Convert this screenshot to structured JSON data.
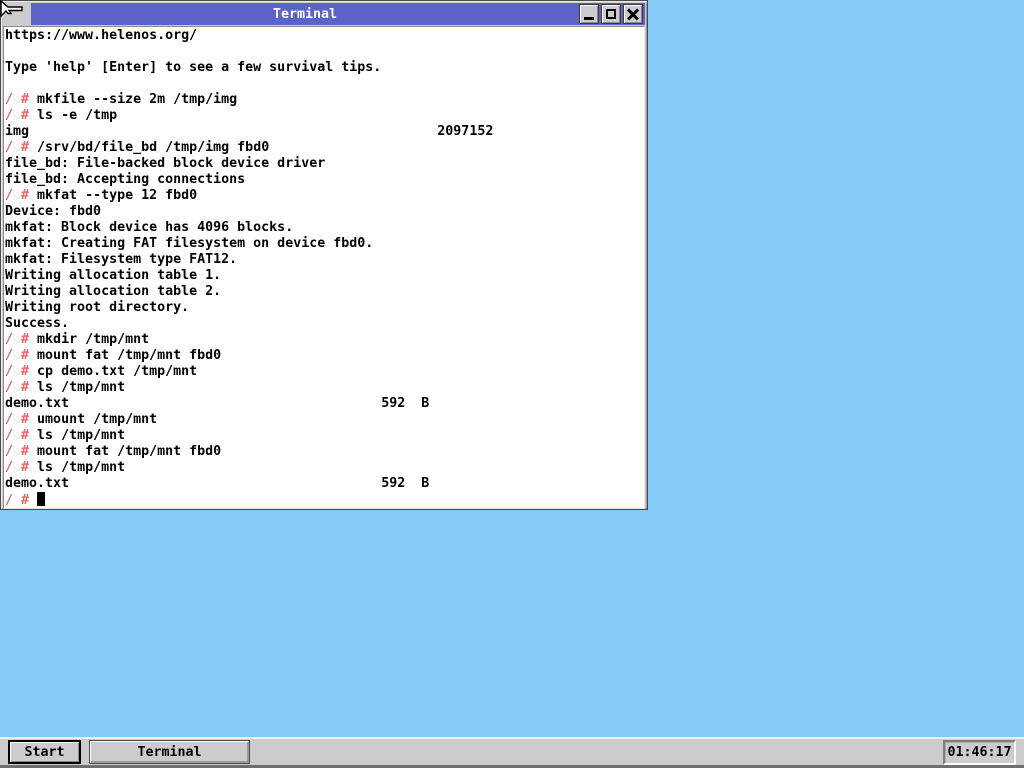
{
  "colors": {
    "desktop": "#84cbfa",
    "titlebar": "#5a64c8",
    "frame": "#cccccc",
    "prompt": "#e06a6a"
  },
  "window": {
    "title": "Terminal",
    "buttons": {
      "minimize_icon": "minimize-icon",
      "maximize_icon": "maximize-icon",
      "close_icon": "close-icon"
    }
  },
  "terminal": {
    "prompt": "/ #",
    "lines": [
      {
        "p": 0,
        "t": "https://www.helenos.org/"
      },
      {
        "p": 0,
        "t": ""
      },
      {
        "p": 0,
        "t": "Type 'help' [Enter] to see a few survival tips."
      },
      {
        "p": 0,
        "t": ""
      },
      {
        "p": 1,
        "t": "mkfile --size 2m /tmp/img"
      },
      {
        "p": 1,
        "t": "ls -e /tmp"
      },
      {
        "p": 0,
        "t": "img                                                   2097152"
      },
      {
        "p": 1,
        "t": "/srv/bd/file_bd /tmp/img fbd0"
      },
      {
        "p": 0,
        "t": "file_bd: File-backed block device driver"
      },
      {
        "p": 0,
        "t": "file_bd: Accepting connections"
      },
      {
        "p": 1,
        "t": "mkfat --type 12 fbd0"
      },
      {
        "p": 0,
        "t": "Device: fbd0"
      },
      {
        "p": 0,
        "t": "mkfat: Block device has 4096 blocks."
      },
      {
        "p": 0,
        "t": "mkfat: Creating FAT filesystem on device fbd0."
      },
      {
        "p": 0,
        "t": "mkfat: Filesystem type FAT12."
      },
      {
        "p": 0,
        "t": "Writing allocation table 1."
      },
      {
        "p": 0,
        "t": "Writing allocation table 2."
      },
      {
        "p": 0,
        "t": "Writing root directory."
      },
      {
        "p": 0,
        "t": "Success."
      },
      {
        "p": 1,
        "t": "mkdir /tmp/mnt"
      },
      {
        "p": 1,
        "t": "mount fat /tmp/mnt fbd0"
      },
      {
        "p": 1,
        "t": "cp demo.txt /tmp/mnt"
      },
      {
        "p": 1,
        "t": "ls /tmp/mnt"
      },
      {
        "p": 0,
        "t": "demo.txt                                       592  B"
      },
      {
        "p": 1,
        "t": "umount /tmp/mnt"
      },
      {
        "p": 1,
        "t": "ls /tmp/mnt"
      },
      {
        "p": 1,
        "t": "mount fat /tmp/mnt fbd0"
      },
      {
        "p": 1,
        "t": "ls /tmp/mnt"
      },
      {
        "p": 0,
        "t": "demo.txt                                       592  B"
      },
      {
        "p": 1,
        "t": "",
        "cursor": true
      }
    ]
  },
  "taskbar": {
    "start_label": "Start",
    "tasks": [
      {
        "label": "Terminal"
      }
    ],
    "clock": "01:46:17"
  }
}
